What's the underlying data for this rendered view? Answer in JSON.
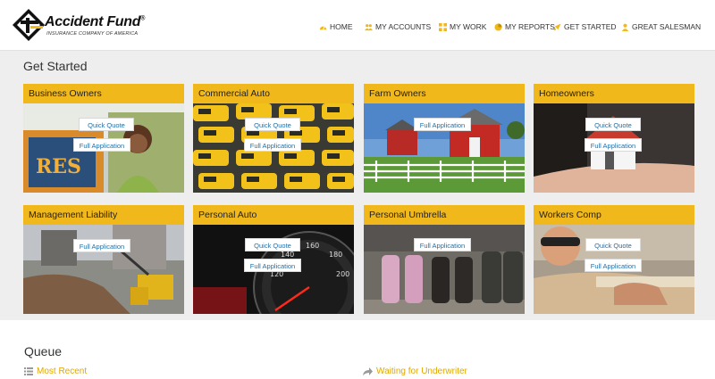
{
  "brand": {
    "name": "Accident Fund",
    "reg": "®",
    "tagline": "INSURANCE COMPANY OF AMERICA"
  },
  "nav": {
    "items": [
      {
        "label": "HOME",
        "icon": "dashboard-icon"
      },
      {
        "label": "MY ACCOUNTS",
        "icon": "users-icon"
      },
      {
        "label": "MY WORK",
        "icon": "grid-icon"
      },
      {
        "label": "MY REPORTS",
        "icon": "pie-chart-icon"
      },
      {
        "label": "GET STARTED",
        "icon": "rocket-icon"
      },
      {
        "label": "GREAT SALESMAN",
        "icon": "user-icon"
      }
    ]
  },
  "get_started": {
    "title": "Get Started",
    "cards": [
      {
        "title": "Business Owners",
        "quick_quote": "Quick Quote",
        "full_application": "Full Application"
      },
      {
        "title": "Commercial Auto",
        "quick_quote": "Quick Quote",
        "full_application": "Full Application"
      },
      {
        "title": "Farm Owners",
        "full_application": "Full Application"
      },
      {
        "title": "Homeowners",
        "quick_quote": "Quick Quote",
        "full_application": "Full Application"
      },
      {
        "title": "Management Liability",
        "full_application": "Full Application"
      },
      {
        "title": "Personal Auto",
        "quick_quote": "Quick Quote",
        "full_application": "Full Application"
      },
      {
        "title": "Personal Umbrella",
        "full_application": "Full Application"
      },
      {
        "title": "Workers Comp",
        "quick_quote": "Quick Quote",
        "full_application": "Full Application"
      }
    ]
  },
  "queue": {
    "title": "Queue",
    "links": [
      {
        "label": "Most Recent",
        "icon": "list-icon"
      },
      {
        "label": "Waiting for Underwriter",
        "icon": "share-icon"
      }
    ]
  },
  "colors": {
    "accent": "#f0b81b",
    "link": "#1f6fa8",
    "queue_link": "#e0a800",
    "section_bg": "#eeeeee"
  }
}
